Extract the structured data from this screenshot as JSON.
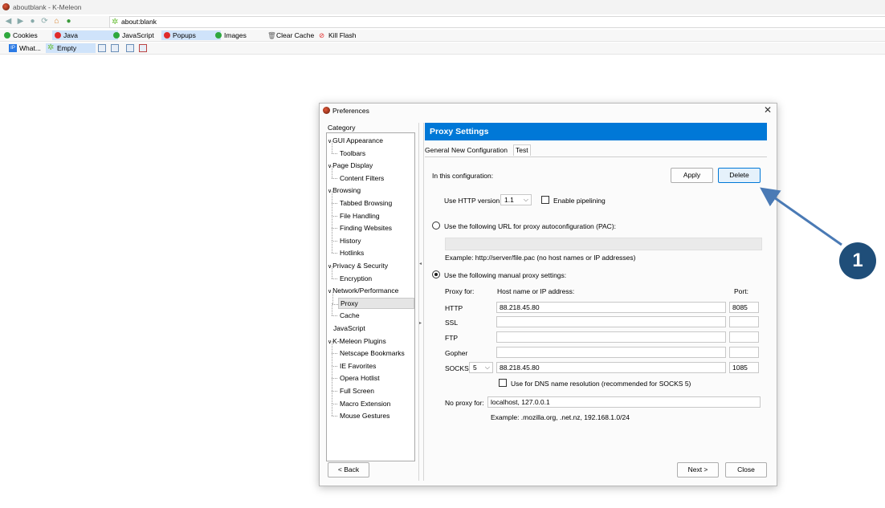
{
  "browser": {
    "window_title": "aboutblank - K-Meleon",
    "url": "about:blank",
    "toggles": [
      {
        "label": "Cookies",
        "state": "on"
      },
      {
        "label": "Java",
        "state": "off"
      },
      {
        "label": "JavaScript",
        "state": "on"
      },
      {
        "label": "Popups",
        "state": "off"
      },
      {
        "label": "Images",
        "state": "on"
      }
    ],
    "clear_cache": "Clear Cache",
    "kill_flash": "Kill Flash",
    "bookmarks": [
      "What...",
      "Empty"
    ]
  },
  "dialog": {
    "title": "Preferences",
    "close_glyph": "✕",
    "category_label": "Category",
    "tree": [
      {
        "label": "GUI Appearance",
        "level": 0,
        "expanded": true
      },
      {
        "label": "Toolbars",
        "level": 1
      },
      {
        "label": "Page Display",
        "level": 0,
        "expanded": true
      },
      {
        "label": "Content Filters",
        "level": 1
      },
      {
        "label": "Browsing",
        "level": 0,
        "expanded": true
      },
      {
        "label": "Tabbed Browsing",
        "level": 1
      },
      {
        "label": "File Handling",
        "level": 1
      },
      {
        "label": "Finding Websites",
        "level": 1
      },
      {
        "label": "History",
        "level": 1
      },
      {
        "label": "Hotlinks",
        "level": 1
      },
      {
        "label": "Privacy & Security",
        "level": 0,
        "expanded": true
      },
      {
        "label": "Encryption",
        "level": 1
      },
      {
        "label": "Network/Performance",
        "level": 0,
        "expanded": true
      },
      {
        "label": "Proxy",
        "level": 1,
        "selected": true
      },
      {
        "label": "Cache",
        "level": 1
      },
      {
        "label": "JavaScript",
        "level": 0
      },
      {
        "label": "K-Meleon Plugins",
        "level": 0,
        "expanded": true
      },
      {
        "label": "Netscape Bookmarks",
        "level": 1
      },
      {
        "label": "IE Favorites",
        "level": 1
      },
      {
        "label": "Opera Hotlist",
        "level": 1
      },
      {
        "label": "Full Screen",
        "level": 1
      },
      {
        "label": "Macro Extension",
        "level": 1
      },
      {
        "label": "Mouse Gestures",
        "level": 1
      }
    ],
    "panel_title": "Proxy Settings",
    "tabs": [
      "General",
      "New Configuration",
      "Test"
    ],
    "in_config_label": "In this configuration:",
    "apply": "Apply",
    "delete": "Delete",
    "http_version_label": "Use HTTP version",
    "http_version": "1.1",
    "enable_pipelining": "Enable pipelining",
    "pac_option": "Use the following URL for proxy autoconfiguration (PAC):",
    "pac_url": "",
    "pac_example": "Example: http://server/file.pac (no host names or IP addresses)",
    "manual_option": "Use the following manual proxy settings:",
    "col_proxy_for": "Proxy for:",
    "col_host": "Host name or IP address:",
    "col_port": "Port:",
    "rows": [
      {
        "label": "HTTP",
        "host": "88.218.45.80",
        "port": "8085"
      },
      {
        "label": "SSL",
        "host": "",
        "port": ""
      },
      {
        "label": "FTP",
        "host": "",
        "port": ""
      },
      {
        "label": "Gopher",
        "host": "",
        "port": ""
      }
    ],
    "socks_label": "SOCKS",
    "socks_version": "5",
    "socks_host": "88.218.45.80",
    "socks_port": "1085",
    "dns_option": "Use for DNS name resolution (recommended for SOCKS 5)",
    "no_proxy_label": "No proxy for:",
    "no_proxy_value": "localhost, 127.0.0.1",
    "no_proxy_example": "Example: .mozilla.org, .net.nz, 192.168.1.0/24",
    "back": "< Back",
    "next": "Next >",
    "close": "Close"
  },
  "annotation": {
    "number": "1",
    "color": "#1f4e79",
    "arrow_color": "#4a7ab5"
  }
}
